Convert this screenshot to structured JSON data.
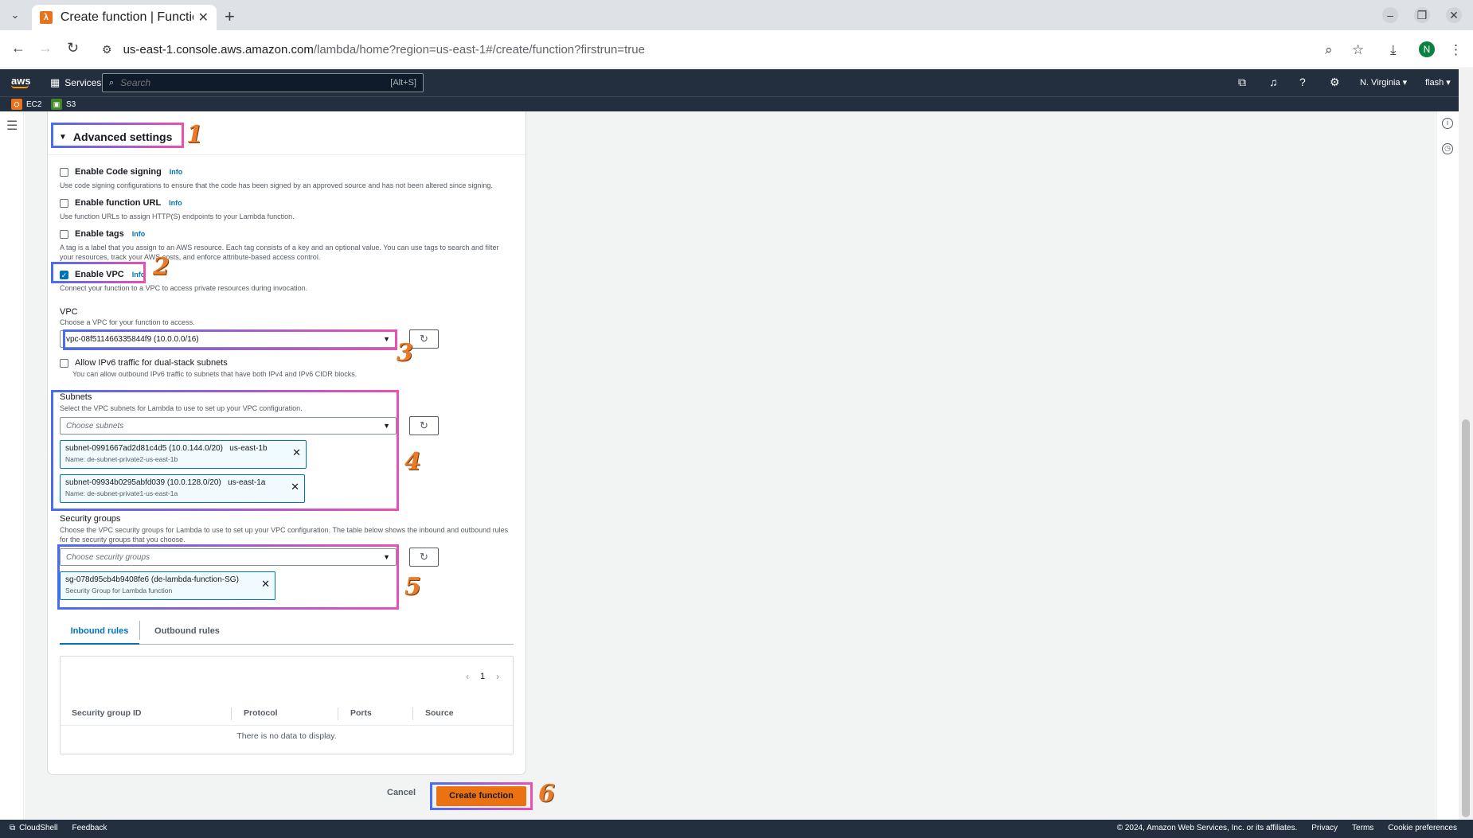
{
  "browser": {
    "tab_title": "Create function | Functio",
    "url_host": "us-east-1.console.aws.amazon.com",
    "url_path": "/lambda/home?region=us-east-1#/create/function?firstrun=true",
    "profile_initial": "N"
  },
  "aws_header": {
    "logo": "aws",
    "services_label": "Services",
    "search_placeholder": "Search",
    "search_hint": "[Alt+S]",
    "region": "N. Virginia ▾",
    "account": "flash ▾",
    "favorites": [
      {
        "label": "EC2",
        "color": "#e8731d"
      },
      {
        "label": "S3",
        "color": "#3f8624"
      }
    ]
  },
  "advanced": {
    "title": "Advanced settings",
    "code_signing": {
      "label": "Enable Code signing",
      "info": "Info",
      "desc": "Use code signing configurations to ensure that the code has been signed by an approved source and has not been altered since signing."
    },
    "function_url": {
      "label": "Enable function URL",
      "info": "Info",
      "desc": "Use function URLs to assign HTTP(S) endpoints to your Lambda function."
    },
    "tags": {
      "label": "Enable tags",
      "info": "Info",
      "desc": "A tag is a label that you assign to an AWS resource. Each tag consists of a key and an optional value. You can use tags to search and filter your resources, track your AWS costs, and enforce attribute-based access control."
    },
    "vpc_enable": {
      "label": "Enable VPC",
      "info": "Info",
      "desc": "Connect your function to a VPC to access private resources during invocation.",
      "checked": true
    },
    "vpc": {
      "label": "VPC",
      "desc": "Choose a VPC for your function to access.",
      "value": "vpc-08f511466335844f9 (10.0.0.0/16)"
    },
    "ipv6": {
      "label": "Allow IPv6 traffic for dual-stack subnets",
      "desc": "You can allow outbound IPv6 traffic to subnets that have both IPv4 and IPv6 CIDR blocks."
    },
    "subnets": {
      "label": "Subnets",
      "desc": "Select the VPC subnets for Lambda to use to set up your VPC configuration.",
      "placeholder": "Choose subnets",
      "items": [
        {
          "id": "subnet-0991667ad2d81c4d5 (10.0.144.0/20)",
          "az": "us-east-1b",
          "name": "Name: de-subnet-private2-us-east-1b"
        },
        {
          "id": "subnet-09934b0295abfd039 (10.0.128.0/20)",
          "az": "us-east-1a",
          "name": "Name: de-subnet-private1-us-east-1a"
        }
      ]
    },
    "security_groups": {
      "label": "Security groups",
      "desc": "Choose the VPC security groups for Lambda to use to set up your VPC configuration. The table below shows the inbound and outbound rules for the security groups that you choose.",
      "placeholder": "Choose security groups",
      "item": {
        "id": "sg-078d95cb4b9408fe6 (de-lambda-function-SG)",
        "desc": "Security Group for Lambda function"
      }
    },
    "rules_tabs": {
      "inbound": "Inbound rules",
      "outbound": "Outbound rules"
    },
    "table": {
      "page": "1",
      "columns": [
        "Security group ID",
        "Protocol",
        "Ports",
        "Source"
      ],
      "empty": "There is no data to display."
    }
  },
  "actions": {
    "cancel": "Cancel",
    "create": "Create function"
  },
  "annotations": [
    "1",
    "2",
    "3",
    "4",
    "5",
    "6"
  ],
  "footer": {
    "cloudshell": "CloudShell",
    "feedback": "Feedback",
    "copyright": "© 2024, Amazon Web Services, Inc. or its affiliates.",
    "links": [
      "Privacy",
      "Terms",
      "Cookie preferences"
    ]
  }
}
